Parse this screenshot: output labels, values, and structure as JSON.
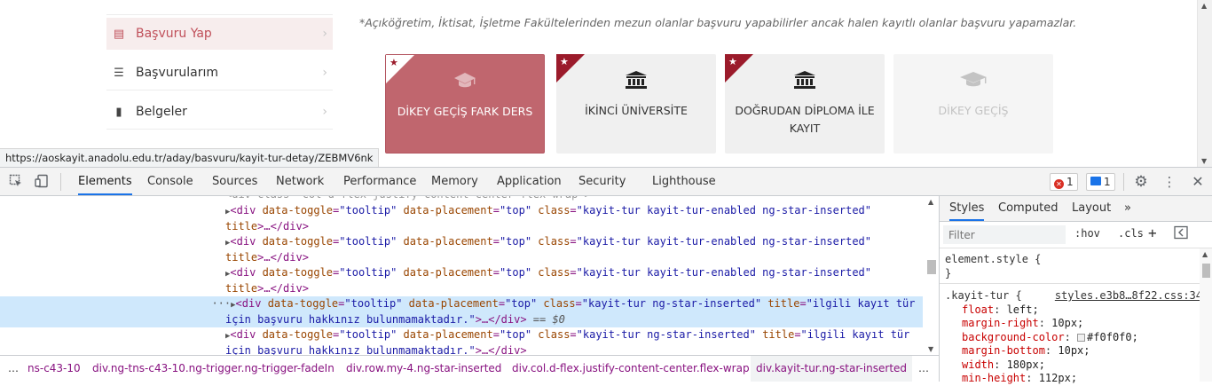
{
  "page": {
    "sidebar": [
      {
        "label": "Başvuru Yap",
        "icon": "id-card-icon",
        "active": true
      },
      {
        "label": "Başvurularım",
        "icon": "list-icon",
        "active": false
      },
      {
        "label": "Belgeler",
        "icon": "document-icon",
        "active": false
      }
    ],
    "notice": "*Açıköğretim, İktisat, İşletme Fakültelerinden mezun olanlar başvuru yapabilirler ancak halen kayıtlı olanlar başvuru yapamazlar.",
    "cards": [
      {
        "line1": "DİKEY GEÇİŞ FARK DERS",
        "line2": "",
        "icon": "graduation-cap-icon",
        "state": "selected",
        "starred": true
      },
      {
        "line1": "İKİNCİ ÜNİVERSİTE",
        "line2": "",
        "icon": "university-icon",
        "state": "enabled",
        "starred": true
      },
      {
        "line1": "DOĞRUDAN DİPLOMA İLE",
        "line2": "KAYIT",
        "icon": "university-icon",
        "state": "enabled",
        "starred": true
      },
      {
        "line1": "DİKEY GEÇİŞ",
        "line2": "",
        "icon": "graduation-cap-icon",
        "state": "disabled",
        "starred": false
      }
    ],
    "status_url": "https://aoskayit.anadolu.edu.tr/aday/basvuru/kayit-tur-detay/ZEBMV6nk"
  },
  "devtools": {
    "tabs": [
      "Elements",
      "Console",
      "Sources",
      "Network",
      "Performance",
      "Memory",
      "Application",
      "Security",
      "Lighthouse"
    ],
    "active_tab": "Elements",
    "error_count": "1",
    "message_count": "1",
    "dom_lines": [
      {
        "kind": "open",
        "attrs": [
          [
            "data-toggle",
            "tooltip"
          ],
          [
            "data-placement",
            "top"
          ],
          [
            "class",
            "kayit-tur kayit-tur-enabled ng-star-inserted"
          ]
        ],
        "cont": "title>…</div>",
        "selected": false
      },
      {
        "kind": "open",
        "attrs": [
          [
            "data-toggle",
            "tooltip"
          ],
          [
            "data-placement",
            "top"
          ],
          [
            "class",
            "kayit-tur kayit-tur-enabled ng-star-inserted"
          ]
        ],
        "cont": "title>…</div>",
        "selected": false
      },
      {
        "kind": "open",
        "attrs": [
          [
            "data-toggle",
            "tooltip"
          ],
          [
            "data-placement",
            "top"
          ],
          [
            "class",
            "kayit-tur kayit-tur-enabled ng-star-inserted"
          ]
        ],
        "cont": "title>…</div>",
        "selected": false
      },
      {
        "kind": "open",
        "attrs": [
          [
            "data-toggle",
            "tooltip"
          ],
          [
            "data-placement",
            "top"
          ],
          [
            "class",
            "kayit-tur ng-star-inserted"
          ],
          [
            "title",
            "ilgili kayıt tür"
          ]
        ],
        "cont": "için başvuru hakkınız bulunmamaktadır.\">…</div> == $0",
        "selected": true
      },
      {
        "kind": "open",
        "attrs": [
          [
            "data-toggle",
            "tooltip"
          ],
          [
            "data-placement",
            "top"
          ],
          [
            "class",
            "kayit-tur ng-star-inserted"
          ],
          [
            "title",
            "ilgili kayıt tür"
          ]
        ],
        "cont": "için başvuru hakkınız bulunmamaktadır.\">…</div>",
        "selected": false
      }
    ],
    "breadcrumbs": [
      "…",
      "ns-c43-10",
      "div.ng-tns-c43-10.ng-trigger.ng-trigger-fadeIn",
      "div.row.my-4.ng-star-inserted",
      "div.col.d-flex.justify-content-center.flex-wrap",
      "div.kayit-tur.ng-star-inserted",
      "…"
    ],
    "styles": {
      "tabs": [
        "Styles",
        "Computed",
        "Layout",
        "»"
      ],
      "active_tab": "Styles",
      "filter_placeholder": "Filter",
      "hov": ":hov",
      "cls": ".cls",
      "element_style": "element.style {",
      "element_style_close": "}",
      "rule_selector": ".kayit-tur {",
      "rule_source": "styles.e3b8…8f22.css:34",
      "declarations": [
        {
          "prop": "float",
          "value": "left;"
        },
        {
          "prop": "margin-right",
          "value": "10px;"
        },
        {
          "prop": "background-color",
          "value": "#f0f0f0;",
          "swatch": "#f0f0f0"
        },
        {
          "prop": "margin-bottom",
          "value": "10px;"
        },
        {
          "prop": "width",
          "value": "180px;"
        },
        {
          "prop": "min-height",
          "value": "112px;"
        }
      ]
    }
  }
}
